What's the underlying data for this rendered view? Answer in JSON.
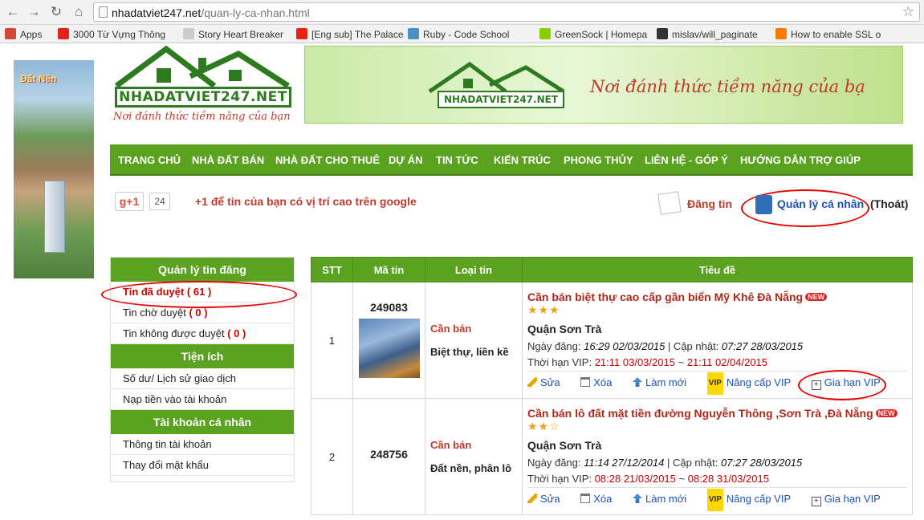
{
  "browser": {
    "url_host": "nhadatviet247.net",
    "url_path": "/quan-ly-ca-nhan.html",
    "bookmarks": [
      {
        "label": "Apps",
        "color": "#d34836"
      },
      {
        "label": "3000 Từ Vựng Thông",
        "color": "#e62117"
      },
      {
        "label": "Story Heart Breaker",
        "color": "#cccccc"
      },
      {
        "label": "[Eng sub] The Palace",
        "color": "#e62117"
      },
      {
        "label": "Ruby - Code School",
        "color": "#4a90c2"
      },
      {
        "label": "GreenSock | Homepa",
        "color": "#88ce02"
      },
      {
        "label": "mislav/will_paginate",
        "color": "#333333"
      },
      {
        "label": "How to enable SSL o",
        "color": "#f57d00"
      }
    ]
  },
  "site": {
    "logo_text": "NHADATVIET247.NET",
    "logo_tagline": "Nơi đánh thức tiềm năng của bạn",
    "banner_logo_text": "NHADATVIET247.NET",
    "banner_slogan": "Nơi đánh thức tiềm năng của bạ",
    "left_banner_title": "Đất Nền"
  },
  "menu": [
    "TRANG CHỦ",
    "NHÀ ĐẤT BÁN",
    "NHÀ ĐẤT CHO THUÊ",
    "DỰ ÁN",
    "TIN TỨC",
    "KIẾN TRÚC",
    "PHONG THỦY",
    "LIÊN HỆ - GÓP Ý",
    "HƯỚNG DẪN TRỢ GIÚP"
  ],
  "social": {
    "gplus_label": "g+1",
    "gplus_count": "24",
    "gplus_text": "+1 để tin của bạn có vị trí cao trên google"
  },
  "header_actions": {
    "post": "Đăng tin",
    "account": "Quản lý cá nhân",
    "logout": "(Thoát)"
  },
  "sidebar": {
    "posts_heading": "Quản lý tin đăng",
    "approved_label": "Tin đã duyệt ( 61 )",
    "pending_label": "Tin chờ duyệt ",
    "pending_count": "( 0 )",
    "rejected_label": "Tin không được duyệt ",
    "rejected_count": "( 0 )",
    "utilities_heading": "Tiện ích",
    "balance": "Số dư/ Lịch sử giao dịch",
    "topup": "Nạp tiền vào tài khoản",
    "account_heading": "Tài khoản cá nhân",
    "account_info": "Thông tin tài khoản",
    "change_password": "Thay đổi mật khẩu"
  },
  "table": {
    "headers": [
      "STT",
      "Mã tin",
      "Loại tin",
      "Tiêu đề"
    ],
    "labels": {
      "posted": "Ngày đăng: ",
      "updated": " | Cập nhật: ",
      "vip_period": "Thời hạn VIP: ",
      "tilde": " ~ ",
      "edit": "Sửa",
      "delete": "Xóa",
      "refresh": "Làm mới",
      "vip_badge": "VIP",
      "upgrade": "Nâng cấp VIP",
      "renew": "Gia hạn VIP",
      "new_badge": "NEW"
    },
    "rows": [
      {
        "stt": "1",
        "code": "249083",
        "kind": "Cần bán",
        "category": "Biệt thự, liền kề",
        "title": "Cần bán biệt thự cao cấp gần biển Mỹ Khê Đà Nẵng",
        "stars": "★★★",
        "star_count": 3,
        "district": "Quận Sơn Trà",
        "posted": "16:29 02/03/2015",
        "updated": "07:27 28/03/2015",
        "vip_start": "21:11 03/03/2015",
        "vip_end": "21:11 02/04/2015"
      },
      {
        "stt": "2",
        "code": "248756",
        "kind": "Cần bán",
        "category": "Đất nền, phân lô",
        "title": "Cần bán lô đất mặt tiền đường Nguyễn Thông ,Sơn Trà ,Đà Nẵng",
        "stars": "★★☆",
        "star_count": 2,
        "district": "Quận Sơn Trà",
        "posted": "11:14 27/12/2014",
        "updated": "07:27 28/03/2015",
        "vip_start": "08:28 21/03/2015",
        "vip_end": "08:28 31/03/2015"
      }
    ]
  },
  "colors": {
    "brand_green": "#5aa21f",
    "brand_red": "#c0392b",
    "link_blue": "#1c52b6",
    "highlight_ring": "#e00000"
  }
}
